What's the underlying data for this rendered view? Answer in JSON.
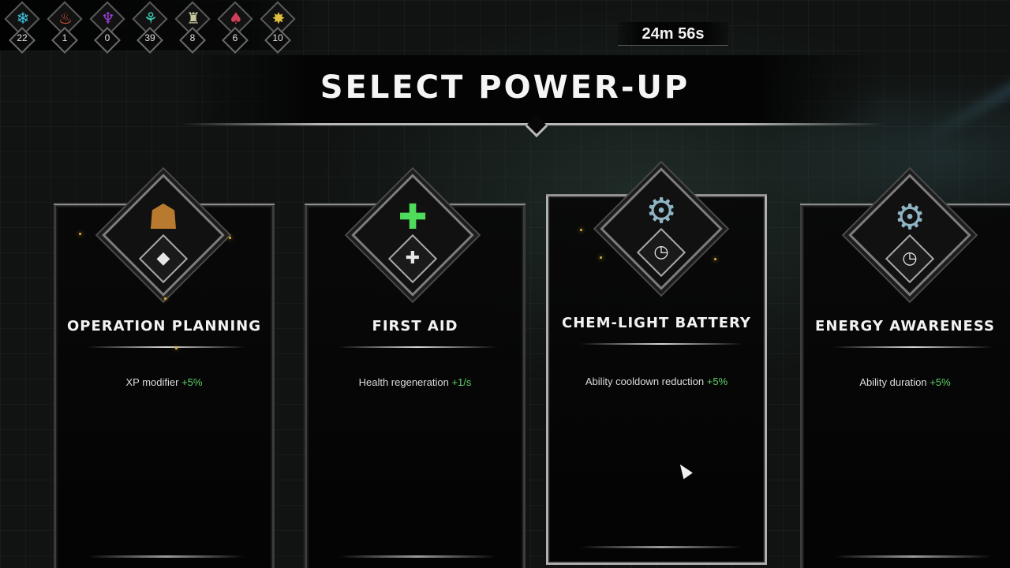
{
  "resources": [
    {
      "icon": "snowflake-icon",
      "glyph": "❄",
      "color": "#3fc7e0",
      "count": "22"
    },
    {
      "icon": "flame-icon",
      "glyph": "♨",
      "color": "#e0573a",
      "count": "1"
    },
    {
      "icon": "purple-crystal-icon",
      "glyph": "♆",
      "color": "#9a3fd0",
      "count": "0"
    },
    {
      "icon": "teal-claw-icon",
      "glyph": "⚘",
      "color": "#3fd0b5",
      "count": "39"
    },
    {
      "icon": "shard-icon",
      "glyph": "♜",
      "color": "#c8c8a0",
      "count": "8"
    },
    {
      "icon": "red-claw-icon",
      "glyph": "♠",
      "color": "#d0405a",
      "count": "6"
    },
    {
      "icon": "lightning-star-icon",
      "glyph": "✸",
      "color": "#e0c040",
      "count": "10"
    }
  ],
  "timer": "24m 56s",
  "title": "SELECT POWER-UP",
  "cards": [
    {
      "name": "OPERATION PLANNING",
      "stat_label": "XP modifier",
      "stat_bonus": "+5%",
      "emblem_icon": "figure-icon",
      "emblem_glyph": "☗",
      "emblem_color": "#b87a2e",
      "badge_icon": "diamond-gem-icon",
      "badge_glyph": "◆"
    },
    {
      "name": "FIRST AID",
      "stat_label": "Health regeneration",
      "stat_bonus": "+1/s",
      "emblem_icon": "medical-cross-icon",
      "emblem_glyph": "✚",
      "emblem_color": "#4fdc5a",
      "badge_icon": "plus-icon",
      "badge_glyph": "✚"
    },
    {
      "name": "CHEM-LIGHT BATTERY",
      "stat_label": "Ability cooldown reduction",
      "stat_bonus": "+5%",
      "emblem_icon": "device-icon",
      "emblem_glyph": "⚙",
      "emblem_color": "#8fb4c4",
      "badge_icon": "stopwatch-icon",
      "badge_glyph": "◷"
    },
    {
      "name": "ENERGY AWARENESS",
      "stat_label": "Ability duration",
      "stat_bonus": "+5%",
      "emblem_icon": "device-icon",
      "emblem_glyph": "⚙",
      "emblem_color": "#8fb4c4",
      "badge_icon": "stopwatch-chevron-icon",
      "badge_glyph": "◷"
    }
  ]
}
